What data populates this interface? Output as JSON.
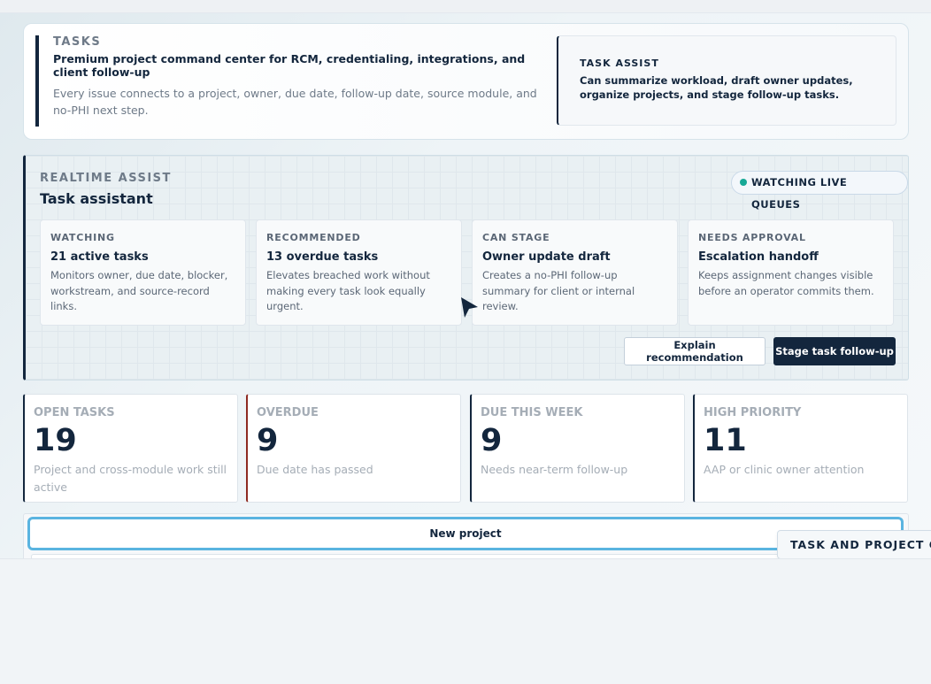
{
  "hero": {
    "eyebrow": "TASKS",
    "title": "Premium project command center for RCM, credentialing, integrations, and client follow-up",
    "description": "Every issue connects to a project, owner, due date, follow-up date, source module, and no-PHI next step.",
    "assist_label": "TASK ASSIST",
    "assist_text": "Can summarize workload, draft owner updates, organize projects, and stage follow-up tasks."
  },
  "realtime": {
    "eyebrow": "REALTIME ASSIST",
    "title": "Task assistant",
    "status_pill": "WATCHING LIVE QUEUES",
    "status_color": "#17a896",
    "cards": [
      {
        "label": "WATCHING",
        "title": "21 active tasks",
        "desc": "Monitors owner, due date, blocker, workstream, and source-record links."
      },
      {
        "label": "RECOMMENDED",
        "title": "13 overdue tasks",
        "desc": "Elevates breached work without making every task look equally urgent."
      },
      {
        "label": "CAN STAGE",
        "title": "Owner update draft",
        "desc": "Creates a no-PHI follow-up summary for client or internal review."
      },
      {
        "label": "NEEDS APPROVAL",
        "title": "Escalation handoff",
        "desc": "Keeps assignment changes visible before an operator commits them."
      }
    ],
    "explain_button": "Explain recommendation",
    "stage_button": "Stage task follow-up"
  },
  "stats": [
    {
      "label": "OPEN TASKS",
      "value": "19",
      "desc": "Project and cross-module work still active"
    },
    {
      "label": "OVERDUE",
      "value": "9",
      "desc": "Due date has passed"
    },
    {
      "label": "DUE THIS WEEK",
      "value": "9",
      "desc": "Needs near-term follow-up"
    },
    {
      "label": "HIGH PRIORITY",
      "value": "11",
      "desc": "AAP or clinic owner attention"
    }
  ],
  "projects": {
    "new_project_button": "New project",
    "floating_tag": "TASK AND PROJECT OPS"
  },
  "colors": {
    "primary": "#13263d",
    "overdue_accent": "#8e2a22",
    "focus_ring": "#5ab4e0"
  }
}
